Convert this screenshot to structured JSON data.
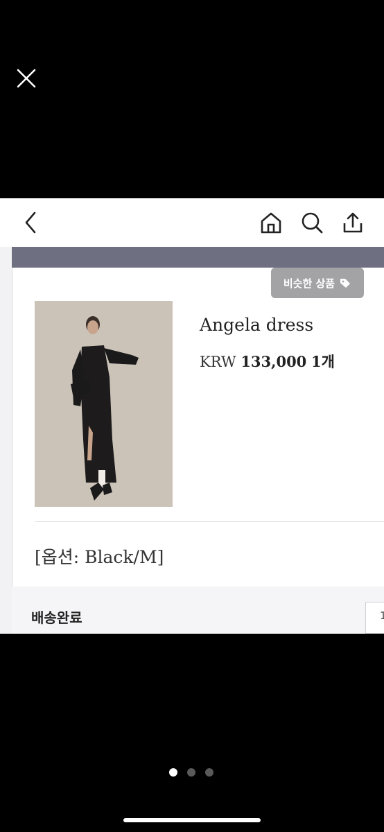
{
  "viewer": {
    "close_icon": "close-icon",
    "page_indicator": {
      "count": 3,
      "active_index": 0
    }
  },
  "shop_nav": {
    "icons": [
      "chevron-left-icon",
      "home-icon",
      "search-icon",
      "share-icon"
    ]
  },
  "order": {
    "similar_button_label": "비슷한 상품",
    "product_name": "Angela dress",
    "price_currency": "KRW",
    "price_amount": "133,000",
    "quantity": "1개",
    "option_text": "[옵션: Black/M]",
    "delivery_status": "배송완료",
    "status_box_text": "1"
  },
  "colors": {
    "header_band": "#6e7081",
    "similar_button": "#a3a3a6",
    "background": "#000000"
  }
}
